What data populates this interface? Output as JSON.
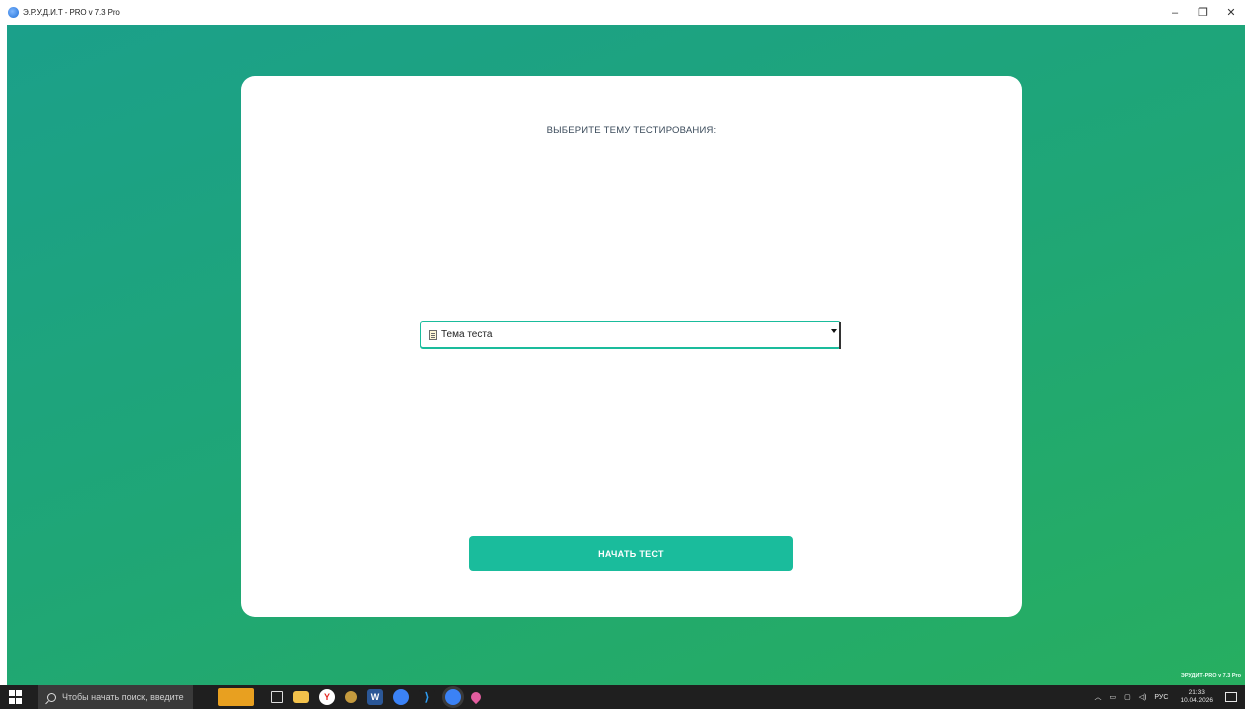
{
  "window": {
    "title": "Э.Р.У.Д.И.Т - PRO v 7.3 Pro",
    "controls": {
      "minimize": "–",
      "maximize": "❐",
      "close": "✕"
    }
  },
  "main": {
    "heading": "ВЫБЕРИТЕ ТЕМУ ТЕСТИРОВАНИЯ:",
    "topic_select": {
      "value": "Тема теста",
      "icon": "notepad-icon"
    },
    "start_button": "НАЧАТЬ ТЕСТ",
    "watermark": "ЭРУДИТ-PRO v 7.3 Pro"
  },
  "colors": {
    "accent": "#1abc9c",
    "background_gradient_start": "#1ba08a",
    "background_gradient_end": "#27ae60"
  },
  "taskbar": {
    "search_placeholder": "Чтобы начать поиск, введите",
    "apps": [
      "cat-app-icon",
      "task-view-icon",
      "file-explorer-icon",
      "yandex-browser-icon",
      "app-icon",
      "word-icon",
      "erudit-icon",
      "vscode-icon",
      "erudit-active-icon",
      "maps-icon"
    ],
    "tray": {
      "language": "РУС",
      "time": "21:33",
      "date": "10.04.2026"
    }
  }
}
